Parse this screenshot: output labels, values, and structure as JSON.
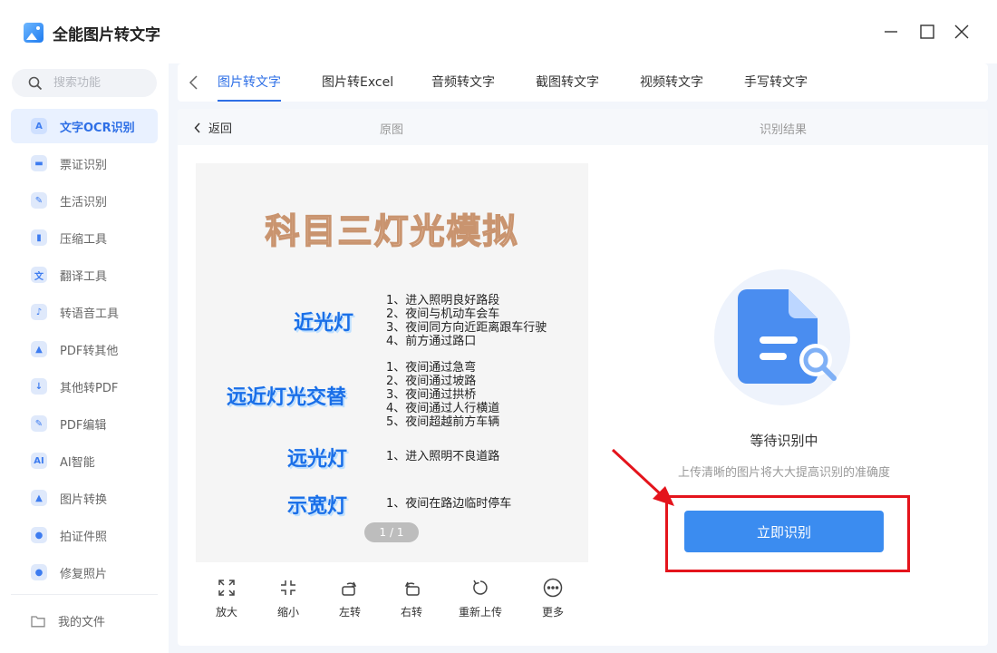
{
  "app": {
    "title": "全能图片转文字"
  },
  "sidebar": {
    "search_placeholder": "搜索功能",
    "items": [
      {
        "label": "文字OCR识别",
        "icon": "A",
        "active": true
      },
      {
        "label": "票证识别",
        "icon": "▬"
      },
      {
        "label": "生活识别",
        "icon": "✎"
      },
      {
        "label": "压缩工具",
        "icon": "▮"
      },
      {
        "label": "翻译工具",
        "icon": "文"
      },
      {
        "label": "转语音工具",
        "icon": "♪"
      },
      {
        "label": "PDF转其他",
        "icon": "▲"
      },
      {
        "label": "其他转PDF",
        "icon": "↓"
      },
      {
        "label": "PDF编辑",
        "icon": "✎"
      },
      {
        "label": "AI智能",
        "icon": "AI"
      },
      {
        "label": "图片转换",
        "icon": "▲"
      },
      {
        "label": "拍证件照",
        "icon": "●"
      },
      {
        "label": "修复照片",
        "icon": "●"
      }
    ],
    "my_files": "我的文件"
  },
  "tabs": [
    "图片转文字",
    "图片转Excel",
    "音频转文字",
    "截图转文字",
    "视频转文字",
    "手写转文字"
  ],
  "content": {
    "back_label": "返回",
    "original_label": "原图",
    "result_label": "识别结果",
    "status": "等待识别中",
    "tip": "上传清晰的图片将大大提高识别的准确度",
    "recognize_button": "立即识别",
    "pager": "1 / 1"
  },
  "preview": {
    "title": "科目三灯光模拟",
    "groups": [
      {
        "category": "近光灯",
        "items": [
          "1、进入照明良好路段",
          "2、夜间与机动车会车",
          "3、夜间同方向近距离跟车行驶",
          "4、前方通过路口"
        ]
      },
      {
        "category": "远近灯光交替",
        "items": [
          "1、夜间通过急弯",
          "2、夜间通过坡路",
          "3、夜间通过拱桥",
          "4、夜间通过人行横道",
          "5、夜间超越前方车辆"
        ]
      },
      {
        "category": "远光灯",
        "items": [
          "1、进入照明不良道路"
        ]
      },
      {
        "category": "示宽灯",
        "items": [
          "1、夜间在路边临时停车"
        ]
      }
    ]
  },
  "toolbar": {
    "zoom_in": "放大",
    "zoom_out": "缩小",
    "rotate_left": "左转",
    "rotate_right": "右转",
    "reupload": "重新上传",
    "more": "更多"
  },
  "colors": {
    "accent": "#2e6fe6",
    "button": "#3b8cf0",
    "highlight": "#e4141c"
  }
}
